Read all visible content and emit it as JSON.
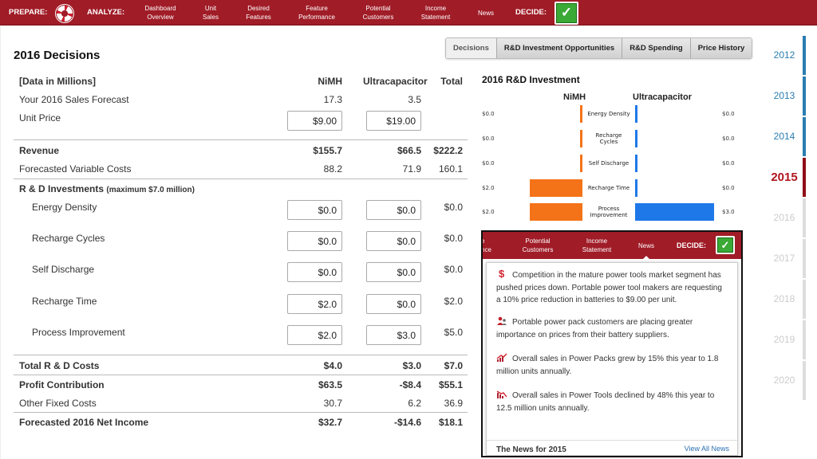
{
  "nav": {
    "prepare": "PREPARE:",
    "analyze": "ANALYZE:",
    "decide": "DECIDE:",
    "items": [
      {
        "l1": "Dashboard",
        "l2": "Overview"
      },
      {
        "l1": "Unit",
        "l2": "Sales"
      },
      {
        "l1": "Desired",
        "l2": "Features"
      },
      {
        "l1": "Feature",
        "l2": "Performance"
      },
      {
        "l1": "Potential",
        "l2": "Customers"
      },
      {
        "l1": "Income",
        "l2": "Statement"
      },
      {
        "l1": "News",
        "l2": ""
      }
    ],
    "check": "✓",
    "prepare_icon": "lifebuoy-icon",
    "decide_icon": "checkmark-icon"
  },
  "title": "2016 Decisions",
  "tabs": [
    "Decisions",
    "R&D Investment Opportunities",
    "R&D Spending",
    "Price History"
  ],
  "table": {
    "header": {
      "label": "[Data in Millions]",
      "c1": "NiMH",
      "c2": "Ultracapacitor",
      "c3": "Total"
    },
    "sales_forecast": {
      "label": "Your 2016 Sales Forecast",
      "c1": "17.3",
      "c2": "3.5"
    },
    "unit_price": {
      "label": "Unit Price",
      "c1": "$9.00",
      "c2": "$19.00"
    },
    "revenue": {
      "label": "Revenue",
      "c1": "$155.7",
      "c2": "$66.5",
      "c3": "$222.2"
    },
    "variable_costs": {
      "label": "Forecasted Variable Costs",
      "c1": "88.2",
      "c2": "71.9",
      "c3": "160.1"
    },
    "rd_header": {
      "label": "R & D Investments",
      "note": "(maximum $7.0 million)"
    },
    "rd_rows": [
      {
        "label": "Energy Density",
        "c1": "$0.0",
        "c2": "$0.0",
        "c3": "$0.0"
      },
      {
        "label": "Recharge Cycles",
        "c1": "$0.0",
        "c2": "$0.0",
        "c3": "$0.0"
      },
      {
        "label": "Self Discharge",
        "c1": "$0.0",
        "c2": "$0.0",
        "c3": "$0.0"
      },
      {
        "label": "Recharge Time",
        "c1": "$2.0",
        "c2": "$0.0",
        "c3": "$2.0"
      },
      {
        "label": "Process Improvement",
        "c1": "$2.0",
        "c2": "$3.0",
        "c3": "$5.0"
      }
    ],
    "total_rd": {
      "label": "Total R & D Costs",
      "c1": "$4.0",
      "c2": "$3.0",
      "c3": "$7.0"
    },
    "profit": {
      "label": "Profit Contribution",
      "c1": "$63.5",
      "c2": "-$8.4",
      "c3": "$55.1"
    },
    "fixed": {
      "label": "Other Fixed Costs",
      "c1": "30.7",
      "c2": "6.2",
      "c3": "36.9"
    },
    "net": {
      "label": "Forecasted 2016 Net Income",
      "c1": "$32.7",
      "c2": "-$14.6",
      "c3": "$18.1"
    }
  },
  "chart_data": {
    "type": "bar",
    "title": "2016 R&D Investment",
    "series_names": [
      "NiMH",
      "Ultracapacitor"
    ],
    "categories": [
      "Energy Density",
      "Recharge Cycles",
      "Self Discharge",
      "Recharge Time",
      "Process Improvement"
    ],
    "category_lines": [
      [
        "Energy Density"
      ],
      [
        "Recharge",
        "Cycles"
      ],
      [
        "Self Discharge"
      ],
      [
        "Recharge Time"
      ],
      [
        "Process",
        "Improvement"
      ]
    ],
    "nimh": [
      0,
      0,
      0,
      2,
      2
    ],
    "ultracapacitor": [
      0,
      0,
      0,
      0,
      3
    ],
    "nimh_labels": [
      "$0.0",
      "$0.0",
      "$0.0",
      "$2.0",
      "$2.0"
    ],
    "ultra_labels": [
      "$0.0",
      "$0.0",
      "$0.0",
      "$0.0",
      "$3.0"
    ],
    "max": 3,
    "colors": {
      "nimh": "#f47318",
      "ultracapacitor": "#1e78e8"
    }
  },
  "years": [
    {
      "y": "2012",
      "state": "past"
    },
    {
      "y": "2013",
      "state": "past"
    },
    {
      "y": "2014",
      "state": "past"
    },
    {
      "y": "2015",
      "state": "cur"
    },
    {
      "y": "2016",
      "state": "future"
    },
    {
      "y": "2017",
      "state": "future"
    },
    {
      "y": "2018",
      "state": "future"
    },
    {
      "y": "2019",
      "state": "future"
    },
    {
      "y": "2020",
      "state": "future"
    }
  ],
  "popup": {
    "nav": [
      {
        "l1": "e",
        "l2": "nce"
      },
      {
        "l1": "Potential",
        "l2": "Customers"
      },
      {
        "l1": "Income",
        "l2": "Statement"
      },
      {
        "l1": "News",
        "l2": ""
      }
    ],
    "decide": "DECIDE:",
    "news": [
      {
        "icon": "dollar-icon",
        "text": "Competition in the mature power tools market segment has pushed prices down. Portable power tool makers are requesting a 10% price reduction in batteries to $9.00 per unit."
      },
      {
        "icon": "people-icon",
        "text": "Portable power pack customers are placing greater importance on prices from their battery suppliers."
      },
      {
        "icon": "trend-up-icon",
        "text": "Overall sales in Power Packs grew by 15% this year to 1.8 million units annually."
      },
      {
        "icon": "trend-down-icon",
        "text": "Overall sales in Power Tools declined by 48% this year to 12.5 million units annually."
      }
    ],
    "footer_title": "The News for 2015",
    "view_all": "View All News"
  },
  "colors": {
    "brand": "#a01c27",
    "past_year": "#2a7db1",
    "current_year": "#b0161f"
  }
}
